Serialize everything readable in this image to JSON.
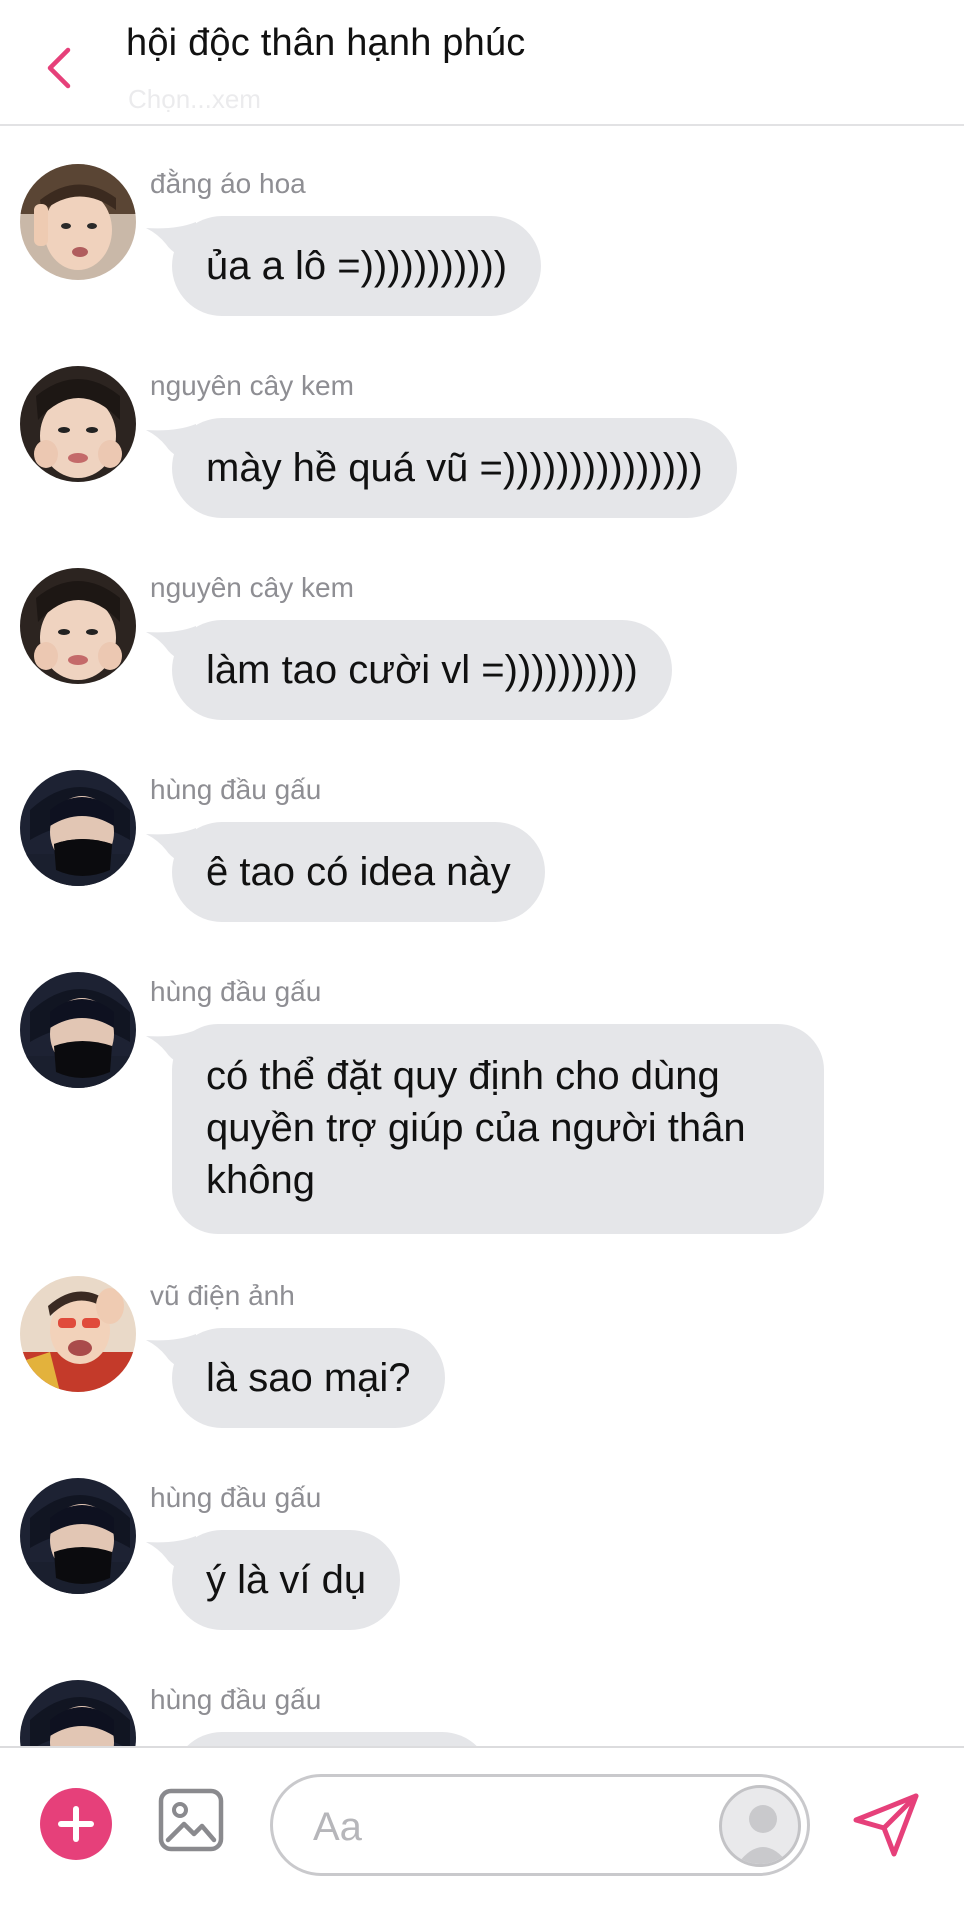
{
  "header": {
    "title": "hội độc thân hạnh phúc",
    "subtitle": "Chọn...xem"
  },
  "messages": [
    {
      "sender": "đằng áo hoa",
      "text": "ủa a lô =)))))))))))",
      "avatar": "avatar-dang-ao-hoa"
    },
    {
      "sender": "nguyên cây kem",
      "text": "mày hề quá vũ =)))))))))))))))",
      "avatar": "avatar-nguyen-cay-kem"
    },
    {
      "sender": "nguyên cây kem",
      "text": "làm tao cười vl =))))))))))",
      "avatar": "avatar-nguyen-cay-kem"
    },
    {
      "sender": "hùng đầu gấu",
      "text": "ê tao có idea này",
      "avatar": "avatar-hung-dau-gau"
    },
    {
      "sender": "hùng đầu gấu",
      "text": "có thể đặt quy định cho dùng quyền trợ giúp của người thân không",
      "avatar": "avatar-hung-dau-gau"
    },
    {
      "sender": "vũ điện ảnh",
      "text": "là sao mại?",
      "avatar": "avatar-vu-dien-anh"
    },
    {
      "sender": "hùng đầu gấu",
      "text": "ý là ví dụ",
      "avatar": "avatar-hung-dau-gau"
    },
    {
      "sender": "hùng đầu gấu",
      "text": "",
      "avatar": "avatar-hung-dau-gau"
    }
  ],
  "composer": {
    "placeholder": "Aa",
    "icons": {
      "add": "plus-icon",
      "image": "image-icon",
      "sticker": "sticker-icon",
      "send": "send-icon",
      "back": "chevron-left-icon"
    }
  },
  "colors": {
    "accent": "#e6407a",
    "bubble": "#e5e6e9",
    "sender_text": "#8e8e93"
  }
}
